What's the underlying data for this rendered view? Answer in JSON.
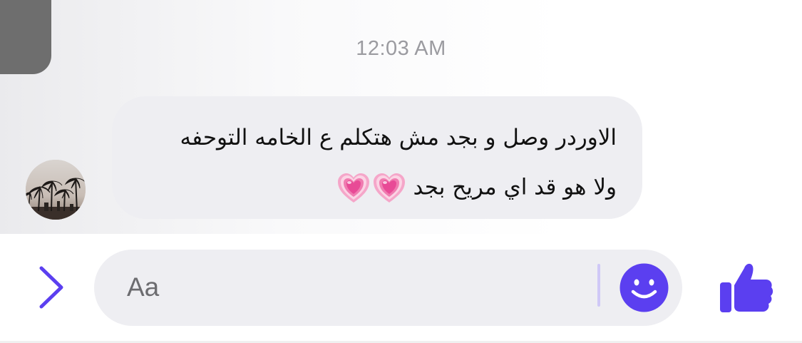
{
  "conversation": {
    "timestamp": "12:03 AM",
    "messages": [
      {
        "sender": "contact",
        "lines": [
          "الاوردر وصل و بجد مش هتكلم ع الخامه التوحفه",
          "ولا هو قد اي مريح بجد"
        ],
        "emoji": [
          "growing-heart",
          "growing-heart"
        ]
      }
    ]
  },
  "composer": {
    "placeholder": "Aa",
    "value": ""
  },
  "icons": {
    "expand": "chevron-right-icon",
    "emoji": "smiley-icon",
    "like": "thumbs-up-icon",
    "avatar": "profile-photo-palm-trees"
  },
  "colors": {
    "accent": "#5b3ff0",
    "bubble": "#eeeef2",
    "timestamp": "#9b9ba0",
    "heart": "#f25aa0"
  }
}
